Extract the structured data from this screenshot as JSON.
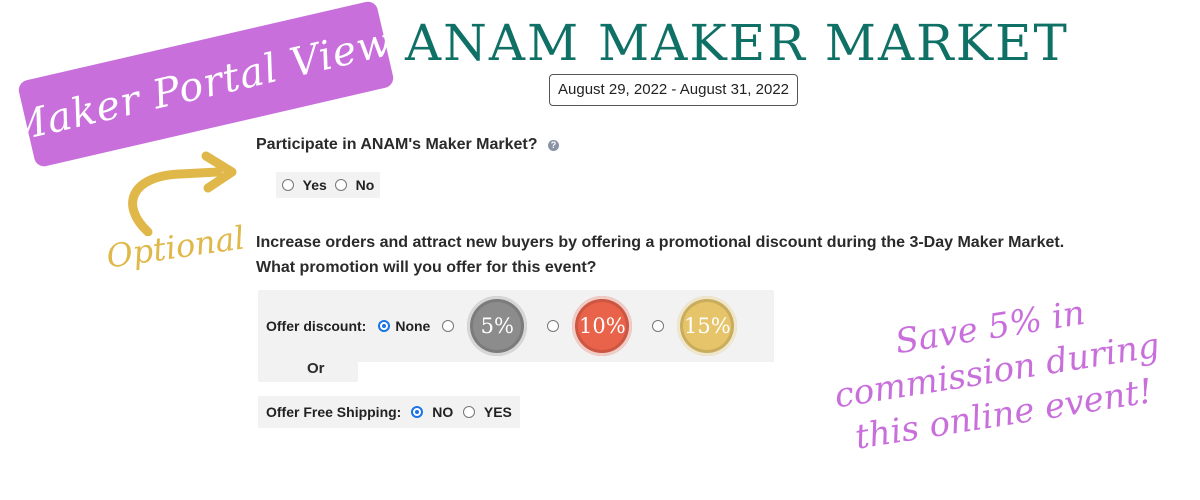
{
  "banner": {
    "text": "Maker Portal View:"
  },
  "title": "ANAM MAKER MARKET",
  "date_range": "August 29, 2022 - August 31, 2022",
  "participate": {
    "question": "Participate in ANAM's Maker Market?",
    "help_icon": "?",
    "options": [
      "Yes",
      "No"
    ]
  },
  "promotion": {
    "line1": "Increase orders and attract new buyers by offering a promotional discount during the 3-Day Maker Market.",
    "line2": "What promotion will you offer for this event?"
  },
  "discount": {
    "label": "Offer discount:",
    "none_label": "None",
    "badges": [
      {
        "label": "5%",
        "color": "#8c8c8c"
      },
      {
        "label": "10%",
        "color": "#e9624a"
      },
      {
        "label": "15%",
        "color": "#e6c46a"
      }
    ]
  },
  "or_text": "Or",
  "free_shipping": {
    "label": "Offer Free Shipping:",
    "options": [
      "NO",
      "YES"
    ]
  },
  "annotations": {
    "optional": "Optional",
    "save_note_lines": [
      "Save 5% in",
      "commission during",
      "this online event!"
    ]
  },
  "colors": {
    "banner": "#c86fdc",
    "title": "#0f7066",
    "accent_gold": "#e0b84a",
    "radio_selected": "#1a73e8"
  }
}
